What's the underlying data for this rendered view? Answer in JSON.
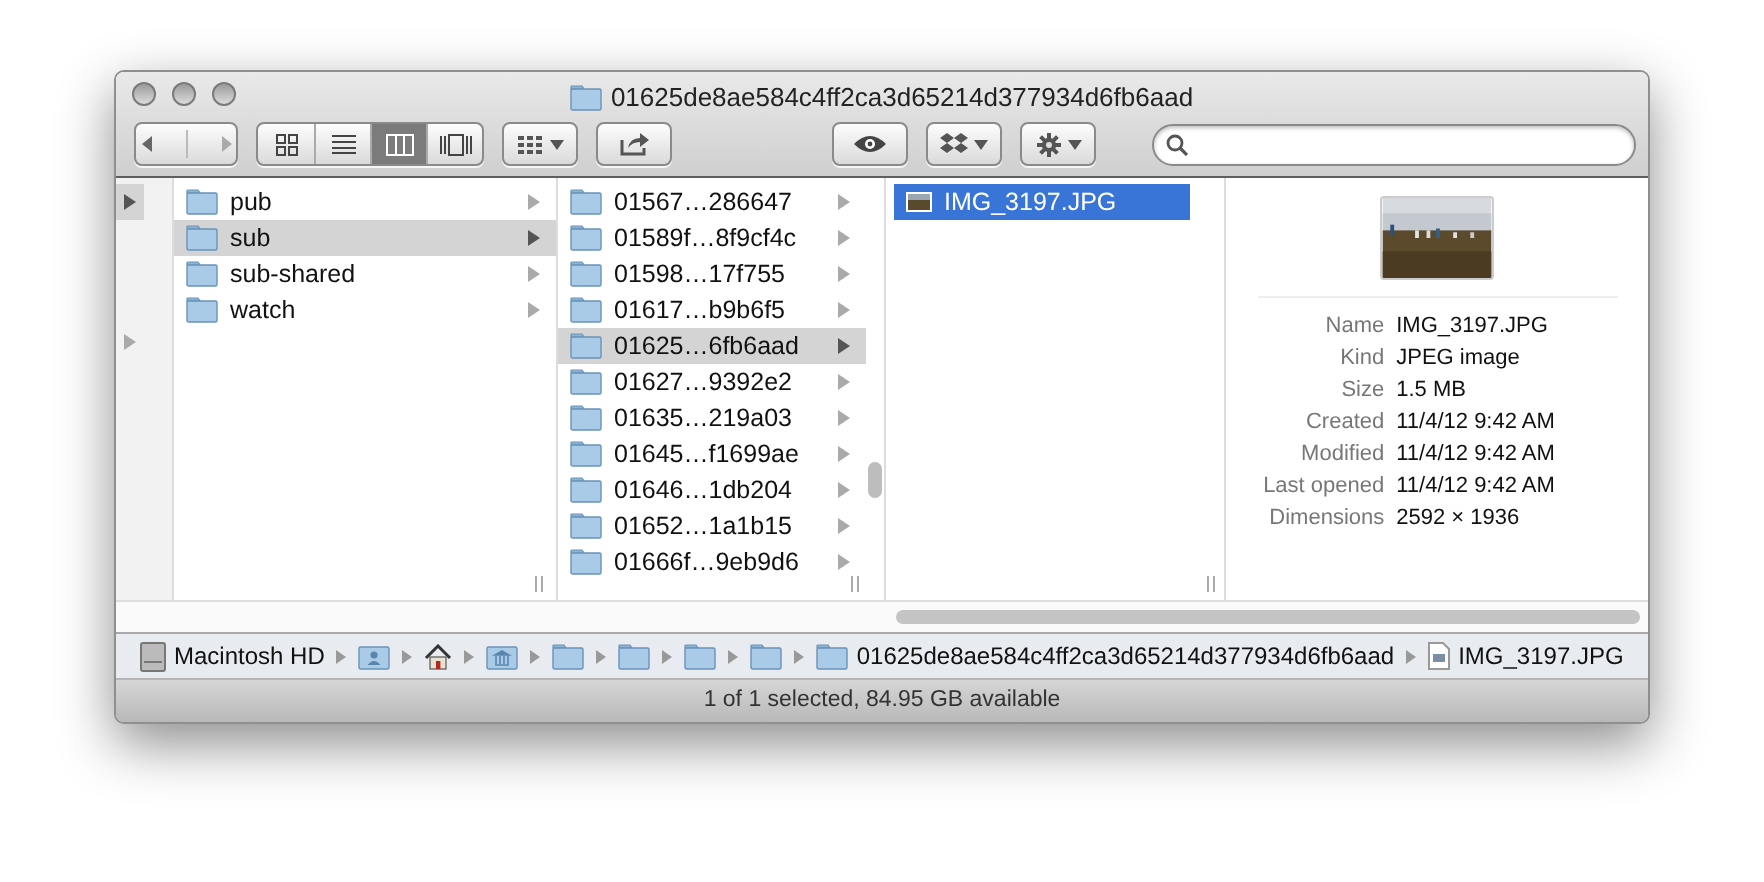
{
  "window": {
    "title": "01625de8ae584c4ff2ca3d65214d377934d6fb6aad"
  },
  "toolbar": {
    "view_modes": [
      {
        "kind": "icons",
        "selected": false
      },
      {
        "kind": "list",
        "selected": false
      },
      {
        "kind": "columns",
        "selected": true
      },
      {
        "kind": "coverflow",
        "selected": false
      }
    ]
  },
  "first_column": [
    {
      "selected": true
    },
    {
      "selected": false
    }
  ],
  "folders_column": [
    {
      "name": "pub",
      "selected": false
    },
    {
      "name": "sub",
      "selected": true
    },
    {
      "name": "sub-shared",
      "selected": false
    },
    {
      "name": "watch",
      "selected": false
    }
  ],
  "items_column": [
    {
      "name": "01567…286647",
      "selected": false
    },
    {
      "name": "01589f…8f9cf4c",
      "selected": false
    },
    {
      "name": "01598…17f755",
      "selected": false
    },
    {
      "name": "01617…b9b6f5",
      "selected": false
    },
    {
      "name": "01625…6fb6aad",
      "selected": true
    },
    {
      "name": "01627…9392e2",
      "selected": false
    },
    {
      "name": "01635…219a03",
      "selected": false
    },
    {
      "name": "01645…f1699ae",
      "selected": false
    },
    {
      "name": "01646…1db204",
      "selected": false
    },
    {
      "name": "01652…1a1b15",
      "selected": false
    },
    {
      "name": "01666f…9eb9d6",
      "selected": false
    }
  ],
  "files_column": [
    {
      "name": "IMG_3197.JPG",
      "selected": true
    }
  ],
  "preview": {
    "info": [
      {
        "label": "Name",
        "value": "IMG_3197.JPG"
      },
      {
        "label": "Kind",
        "value": "JPEG image"
      },
      {
        "label": "Size",
        "value": "1.5 MB"
      },
      {
        "label": "Created",
        "value": "11/4/12 9:42 AM"
      },
      {
        "label": "Modified",
        "value": "11/4/12 9:42 AM"
      },
      {
        "label": "Last opened",
        "value": "11/4/12 9:42 AM"
      },
      {
        "label": "Dimensions",
        "value": "2592 × 1936"
      }
    ]
  },
  "path_bar": [
    {
      "kind": "disk",
      "label": "Macintosh HD"
    },
    {
      "kind": "user-folder"
    },
    {
      "kind": "home"
    },
    {
      "kind": "apps-folder"
    },
    {
      "kind": "folder"
    },
    {
      "kind": "folder"
    },
    {
      "kind": "folder"
    },
    {
      "kind": "folder"
    },
    {
      "kind": "folder",
      "label": "01625de8ae584c4ff2ca3d65214d377934d6fb6aad"
    },
    {
      "kind": "file",
      "label": "IMG_3197.JPG"
    }
  ],
  "status_bar": "1 of 1 selected, 84.95 GB available"
}
